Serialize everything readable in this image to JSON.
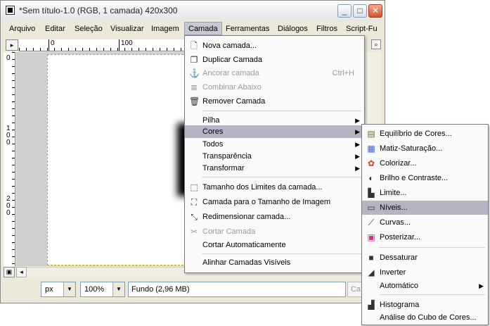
{
  "window": {
    "title": "*Sem título-1.0 (RGB, 1 camada) 420x300",
    "controls": [
      "_",
      "□",
      "✕"
    ]
  },
  "menubar": {
    "items": [
      "Arquivo",
      "Editar",
      "Seleção",
      "Visualizar",
      "Imagem",
      "Camada",
      "Ferramentas",
      "Diálogos",
      "Filtros",
      "Script-Fu"
    ],
    "active": "Camada"
  },
  "rulers": {
    "h_ticks": [
      "0",
      "100"
    ],
    "v_ticks": [
      "0",
      "100",
      "200"
    ]
  },
  "statusbar": {
    "unit": "px",
    "zoom": "100%",
    "info": "Fundo (2,96 MB)",
    "cancel": "Ca"
  },
  "layer_menu": {
    "items": [
      {
        "label": "Nova camada...",
        "icon": "new-layer-icon",
        "enabled": true
      },
      {
        "label": "Duplicar Camada",
        "icon": "duplicate-icon",
        "enabled": true
      },
      {
        "label": "Ancorar camada",
        "icon": "anchor-icon",
        "enabled": false,
        "shortcut": "Ctrl+H"
      },
      {
        "label": "Combinar Abaixo",
        "icon": "merge-down-icon",
        "enabled": false
      },
      {
        "label": "Remover Camada",
        "icon": "trash-icon",
        "enabled": true
      },
      {
        "label": "Pilha",
        "submenu": true
      },
      {
        "label": "Cores",
        "submenu": true,
        "highlighted": true
      },
      {
        "label": "Todos",
        "submenu": true
      },
      {
        "label": "Transparência",
        "submenu": true
      },
      {
        "label": "Transformar",
        "submenu": true
      },
      {
        "label": "Tamanho dos Limites da camada...",
        "icon": "layer-boundary-icon",
        "enabled": true
      },
      {
        "label": "Camada para o Tamanho de Imagem",
        "icon": "layer-to-image-icon",
        "enabled": true
      },
      {
        "label": "Redimensionar camada...",
        "icon": "scale-layer-icon",
        "enabled": true
      },
      {
        "label": "Cortar Camada",
        "icon": "crop-icon",
        "enabled": false
      },
      {
        "label": "Cortar Automaticamente",
        "enabled": true
      },
      {
        "label": "Alinhar Camadas Visíveis",
        "enabled": true
      }
    ]
  },
  "colors_menu": {
    "items": [
      {
        "label": "Equilíbrio de Cores...",
        "icon": "color-balance-icon"
      },
      {
        "label": "Matiz-Saturação...",
        "icon": "hue-saturation-icon"
      },
      {
        "label": "Colorizar...",
        "icon": "colorize-icon"
      },
      {
        "label": "Brilho e Contraste...",
        "icon": "brightness-contrast-icon"
      },
      {
        "label": "Limite...",
        "icon": "threshold-icon"
      },
      {
        "label": "Níveis...",
        "icon": "levels-icon",
        "highlighted": true
      },
      {
        "label": "Curvas...",
        "icon": "curves-icon"
      },
      {
        "label": "Posterizar...",
        "icon": "posterize-icon"
      },
      {
        "label": "Dessaturar",
        "icon": "desaturate-icon"
      },
      {
        "label": "Inverter",
        "icon": "invert-icon"
      },
      {
        "label": "Automático",
        "submenu": true
      },
      {
        "label": "Histograma",
        "icon": "histogram-icon"
      },
      {
        "label": "Análise do Cubo de Cores..."
      }
    ]
  }
}
